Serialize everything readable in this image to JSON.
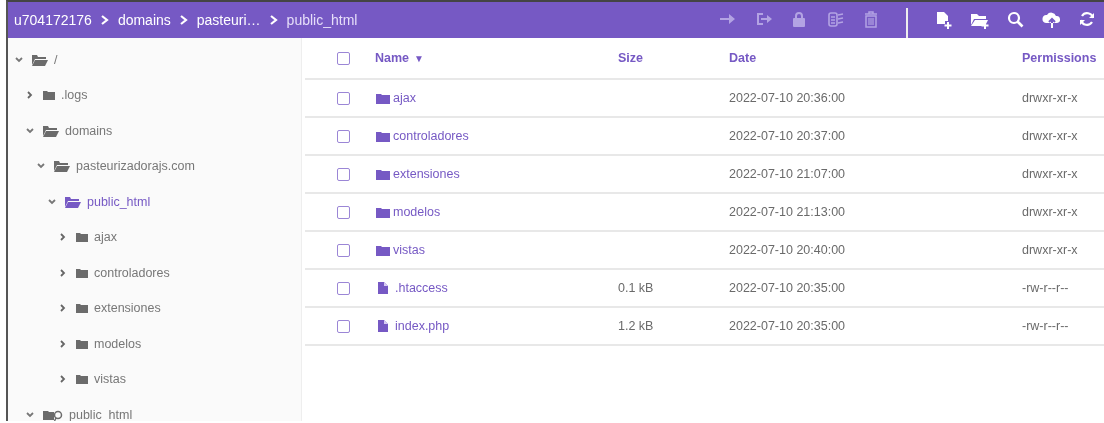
{
  "breadcrumb": [
    {
      "label": "u704172176"
    },
    {
      "label": "domains"
    },
    {
      "label": "pasteuri…"
    },
    {
      "label": "public_html"
    }
  ],
  "toolbar": [
    {
      "disabled": true
    },
    {
      "disabled": true
    },
    {
      "disabled": true
    },
    {
      "disabled": true
    },
    {
      "disabled": true
    },
    {
      "disabled": false
    },
    {
      "disabled": false
    },
    {
      "disabled": false
    },
    {
      "disabled": false
    },
    {
      "disabled": false
    }
  ],
  "tree": [
    {
      "label": "/",
      "kind": "folder",
      "expanded": true,
      "selected": false,
      "children": [
        {
          "label": ".logs",
          "kind": "folder",
          "expanded": false,
          "selected": false
        },
        {
          "label": "domains",
          "kind": "folder",
          "expanded": true,
          "selected": false,
          "children": [
            {
              "label": "pasteurizadorajs.com",
              "kind": "folder",
              "expanded": true,
              "selected": false,
              "children": [
                {
                  "label": "public_html",
                  "kind": "folder",
                  "expanded": true,
                  "selected": true,
                  "children": [
                    {
                      "label": "ajax",
                      "kind": "folder",
                      "expanded": false,
                      "selected": false
                    },
                    {
                      "label": "controladores",
                      "kind": "folder",
                      "expanded": false,
                      "selected": false
                    },
                    {
                      "label": "extensiones",
                      "kind": "folder",
                      "expanded": false,
                      "selected": false
                    },
                    {
                      "label": "modelos",
                      "kind": "folder",
                      "expanded": false,
                      "selected": false
                    },
                    {
                      "label": "vistas",
                      "kind": "folder",
                      "expanded": false,
                      "selected": false
                    }
                  ]
                }
              ]
            }
          ]
        },
        {
          "label": "public_html",
          "kind": "symlink",
          "expanded": true,
          "selected": false
        }
      ]
    }
  ],
  "table": {
    "columns": [
      {
        "label": "Name",
        "sort": "▼"
      },
      {
        "label": "Size"
      },
      {
        "label": "Date"
      },
      {
        "label": "Permissions"
      }
    ],
    "select_all": {
      "checked": false
    },
    "rows": [
      {
        "kind": "folder",
        "name": "ajax",
        "size": "",
        "date": "2022-07-10 20:36:00",
        "permissions": "drwxr-xr-x",
        "checked": false
      },
      {
        "kind": "folder",
        "name": "controladores",
        "size": "",
        "date": "2022-07-10 20:37:00",
        "permissions": "drwxr-xr-x",
        "checked": false
      },
      {
        "kind": "folder",
        "name": "extensiones",
        "size": "",
        "date": "2022-07-10 21:07:00",
        "permissions": "drwxr-xr-x",
        "checked": false
      },
      {
        "kind": "folder",
        "name": "modelos",
        "size": "",
        "date": "2022-07-10 21:13:00",
        "permissions": "drwxr-xr-x",
        "checked": false
      },
      {
        "kind": "folder",
        "name": "vistas",
        "size": "",
        "date": "2022-07-10 20:40:00",
        "permissions": "drwxr-xr-x",
        "checked": false
      },
      {
        "kind": "file",
        "name": ".htaccess",
        "size": "0.1 kB",
        "date": "2022-07-10 20:35:00",
        "permissions": "-rw-r--r--",
        "checked": false
      },
      {
        "kind": "file",
        "name": "index.php",
        "size": "1.2 kB",
        "date": "2022-07-10 20:35:00",
        "permissions": "-rw-r--r--",
        "checked": false
      }
    ]
  }
}
